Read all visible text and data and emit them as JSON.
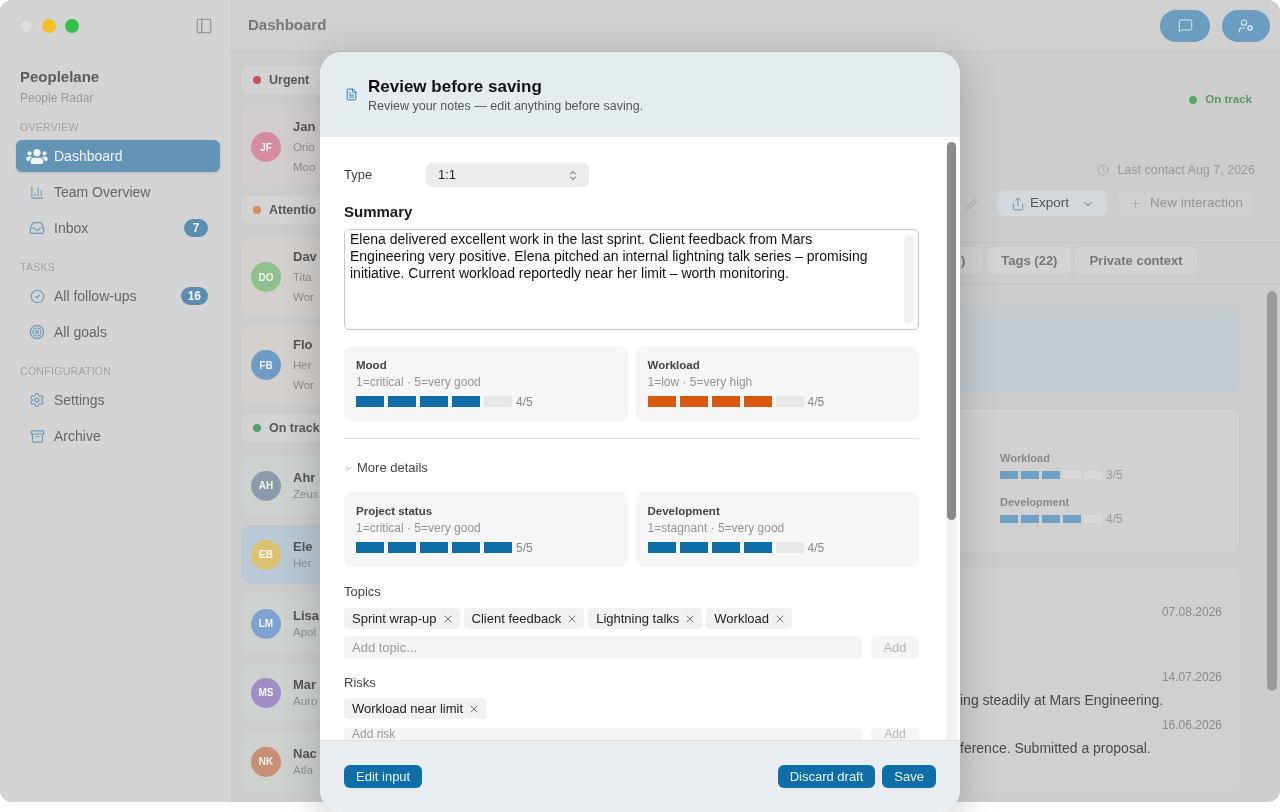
{
  "header": {
    "title": "Dashboard"
  },
  "sidebar": {
    "app_name": "Peoplelane",
    "subtitle": "People Radar",
    "sections": [
      {
        "title": "OVERVIEW",
        "items": [
          {
            "label": "Dashboard",
            "selected": true
          },
          {
            "label": "Team Overview",
            "selected": false
          },
          {
            "label": "Inbox",
            "selected": false,
            "badge": "7"
          }
        ]
      },
      {
        "title": "TASKS",
        "items": [
          {
            "label": "All follow-ups",
            "selected": false,
            "badge": "16"
          },
          {
            "label": "All goals",
            "selected": false
          }
        ]
      },
      {
        "title": "CONFIGURATION",
        "items": [
          {
            "label": "Settings",
            "selected": false
          },
          {
            "label": "Archive",
            "selected": false
          }
        ]
      }
    ]
  },
  "people_list": {
    "groups": [
      {
        "title": "Urgent",
        "color": "#c2525e",
        "people": [
          {
            "initials": "JF",
            "color": "#d58c9e",
            "name": "Jan",
            "subtitle": "Orio",
            "note": "Moo",
            "selected": false
          }
        ]
      },
      {
        "title": "Attentio",
        "color": "#d58a5e",
        "people": [
          {
            "initials": "DO",
            "color": "#8dc28f",
            "name": "Dav",
            "subtitle": "Tita",
            "note": "Wor",
            "selected": false
          },
          {
            "initials": "FB",
            "color": "#6d9dc4",
            "name": "Flo",
            "subtitle": "Her",
            "note": "Wor",
            "selected": false
          }
        ]
      },
      {
        "title": "On track",
        "color": "#4fa26e",
        "people": [
          {
            "initials": "AH",
            "color": "#8b9bab",
            "name": "Ahr",
            "subtitle": "Zeus",
            "selected": false
          },
          {
            "initials": "EB",
            "color": "#dcc26e",
            "name": "Ele",
            "subtitle": "Her",
            "selected": true
          },
          {
            "initials": "LM",
            "color": "#7ea3d3",
            "name": "Lisa",
            "subtitle": "Apol",
            "selected": false
          },
          {
            "initials": "MS",
            "color": "#a08dc6",
            "name": "Mar",
            "subtitle": "Auro",
            "selected": false
          },
          {
            "initials": "NK",
            "color": "#c98f75",
            "name": "Nac",
            "subtitle": "Atla",
            "selected": false
          }
        ]
      }
    ]
  },
  "detail": {
    "status": "On track",
    "last_contact": "Last contact Aug 7, 2026",
    "actions": [
      {
        "label": "Export",
        "disabled": false
      },
      {
        "label": "New interaction",
        "disabled": true
      }
    ],
    "tabs": [
      {
        "label": ")",
        "selected": false
      },
      {
        "label": "Tags (22)",
        "selected": false
      },
      {
        "label": "Private context",
        "selected": false
      }
    ],
    "ratings": [
      {
        "label": "Workload",
        "level": 0.6,
        "reading": "3/5"
      },
      {
        "label": "Development",
        "level": 0.8,
        "reading": "4/5"
      }
    ],
    "timeline": [
      {
        "date": "07.08.2026"
      },
      {
        "date": "14.07.2026",
        "text": "ing steadily at Mars Engineering."
      },
      {
        "date": "16.06.2026",
        "text": "ference. Submitted a proposal."
      }
    ]
  },
  "dialog": {
    "title": "Review before saving",
    "subtitle": "Review your notes — edit anything before saving.",
    "type": {
      "label": "Type",
      "value": "1:1"
    },
    "summary": {
      "label": "Summary",
      "value": "Elena delivered excellent work in the last sprint. Client feedback from Mars Engineering very positive. Elena pitched an internal lightning talk series – promising initiative. Current workload reportedly near her limit – worth monitoring."
    },
    "ratings": [
      {
        "label": "Mood",
        "scale": "1=critical · 5=very good",
        "level": 0.8,
        "reading": "4/5",
        "color": "#0f6ea8"
      },
      {
        "label": "Workload",
        "scale": "1=low · 5=very high",
        "level": 0.8,
        "reading": "4/5",
        "color": "#d9580f"
      }
    ],
    "more_details": {
      "label": "More details",
      "expanded": true,
      "ratings": [
        {
          "label": "Project status",
          "scale": "1=critical · 5=very good",
          "level": 1,
          "reading": "5/5"
        },
        {
          "label": "Development",
          "scale": "1=stagnant · 5=very good",
          "level": 0.8,
          "reading": "4/5"
        }
      ]
    },
    "topics": {
      "label": "Topics",
      "chips": [
        "Sprint wrap-up",
        "Client feedback",
        "Lightning talks",
        "Workload"
      ],
      "placeholder": "Add topic...",
      "add_button": {
        "label": "Add",
        "disabled": true
      }
    },
    "risks": {
      "label": "Risks",
      "chips": [
        "Workload near limit"
      ],
      "placeholder": "Add risk",
      "add_button": {
        "label": "Add",
        "disabled": true
      }
    },
    "footer": {
      "left_buttons": [
        {
          "label": "Edit input"
        }
      ],
      "right_buttons": [
        {
          "label": "Discard draft"
        },
        {
          "label": "Save"
        }
      ]
    }
  }
}
